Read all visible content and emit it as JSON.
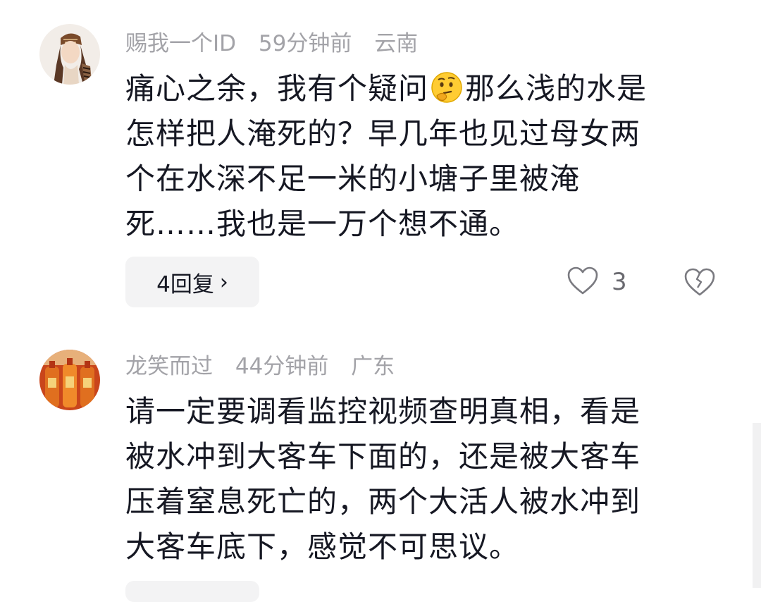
{
  "comments": [
    {
      "username": "赐我一个ID",
      "time": "59分钟前",
      "location": "云南",
      "lines": [
        {
          "before": "痛心之余，我有个疑问",
          "emoji": "thinking-face-emoji",
          "after": "那么浅的水是"
        },
        {
          "text": "怎样把人淹死的？早几年也见过母女两"
        },
        {
          "text": "个在水深不足一米的小塘子里被淹"
        },
        {
          "text": "死……我也是一万个想不通。"
        }
      ],
      "reply_label": "4回复",
      "reply_chevron": "›",
      "like_count": "3"
    },
    {
      "username": "龙笑而过",
      "time": "44分钟前",
      "location": "广东",
      "lines": [
        {
          "text": "请一定要调看监控视频查明真相，看是"
        },
        {
          "text": "被水冲到大客车下面的，还是被大客车"
        },
        {
          "text": "压着窒息死亡的，两个大活人被水冲到"
        },
        {
          "text": "大客车底下，感觉不可思议。"
        }
      ]
    }
  ],
  "colors": {
    "meta_text": "#a3a3a8",
    "body_text": "#161823",
    "reply_bg": "#f3f3f4",
    "icon_stroke": "#7a7a80"
  }
}
